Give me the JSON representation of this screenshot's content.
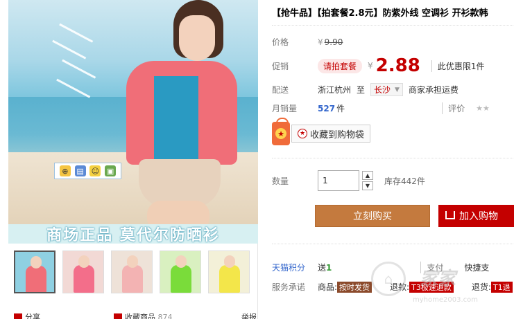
{
  "gallery": {
    "banner_text": "商场正品  莫代尔防晒衫",
    "toolbar_icons": [
      "zoom-icon",
      "save-icon",
      "emoji-icon",
      "image-edit-icon"
    ],
    "thumbnails": [
      {
        "bg": "#8fd0e2",
        "top": "#f06e78",
        "active": true
      },
      {
        "bg": "#f2d9d5",
        "top": "#f36e8a",
        "active": false
      },
      {
        "bg": "#eee2d8",
        "top": "#f3b3b3",
        "active": false
      },
      {
        "bg": "#d9f0c0",
        "top": "#7adc3a",
        "active": false
      },
      {
        "bg": "#f3f0d8",
        "top": "#f3e64a",
        "active": false
      }
    ],
    "bottom": {
      "share": "分享",
      "collect": "收藏商品",
      "collect_count": "874",
      "report": "举报"
    }
  },
  "product": {
    "title": "【抢牛品】【拍套餐2.8元】防紫外线 空调衫 开衫款韩",
    "price_label": "价格",
    "price_currency": "¥",
    "price_original": "9.90",
    "promo_label": "促销",
    "promo_tag": "请拍套餐",
    "promo_currency": "¥",
    "promo_price": "2.88",
    "promo_limit": "此优惠限1件",
    "delivery_label": "配送",
    "delivery_from": "浙江杭州",
    "delivery_to_word": "至",
    "delivery_city": "长沙",
    "delivery_shipping": "商家承担运费",
    "sales_label": "月销量",
    "sales_count": "527",
    "sales_unit": "件",
    "rating_label": "评价",
    "rating_stars": "★★",
    "favorite_label": "收藏到购物袋",
    "qty_label": "数量",
    "qty_value": "1",
    "stock": "库存442件",
    "buy_now": "立刻购买",
    "add_to_cart": "加入购物",
    "points_label": "天猫积分",
    "points_prefix": "送",
    "points_value": "1",
    "pay_label": "支付",
    "pay_value": "快捷支",
    "service_label": "服务承诺",
    "service_goods": "商品:",
    "service_goods_tag": "按时发货",
    "service_refund": "退款:",
    "service_refund_tag": "T3极速退款",
    "service_return": "退货:",
    "service_return_tag": "T1退"
  },
  "watermark": {
    "text": "家家",
    "url": "myhome2003.com"
  },
  "colors": {
    "accent_red": "#c40000",
    "buy_brown": "#c47a3e",
    "link_blue": "#3366cc"
  }
}
